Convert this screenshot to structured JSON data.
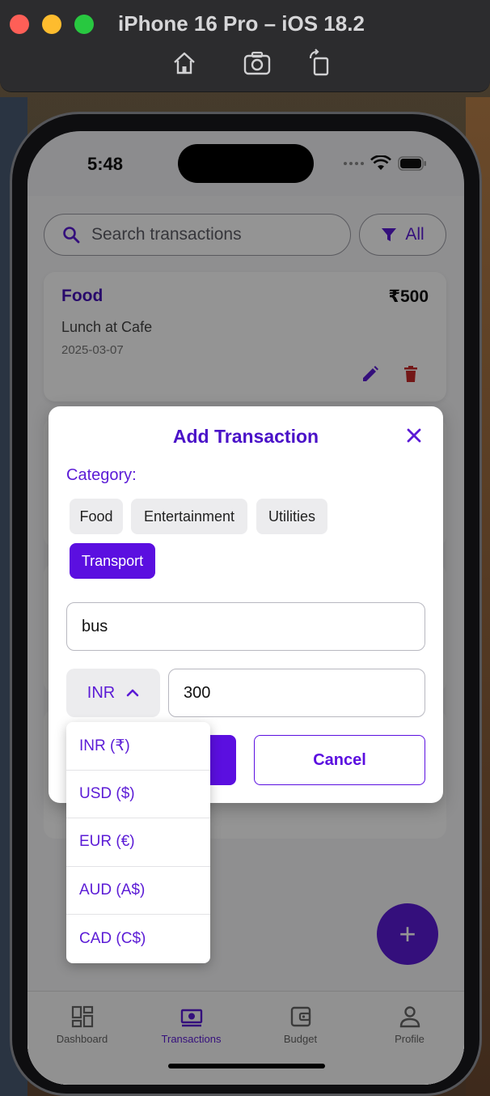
{
  "simulator": {
    "title": "iPhone 16 Pro – iOS 18.2",
    "tools": [
      "home-icon",
      "screenshot-icon",
      "rotate-icon"
    ]
  },
  "status_bar": {
    "time": "5:48"
  },
  "search": {
    "placeholder": "Search transactions"
  },
  "filter": {
    "label": "All"
  },
  "transaction": {
    "category": "Food",
    "amount": "₹500",
    "description": "Lunch at Cafe",
    "date": "2025-03-07"
  },
  "modal": {
    "title": "Add Transaction",
    "category_label": "Category:",
    "categories": [
      "Food",
      "Entertainment",
      "Utilities",
      "Transport"
    ],
    "selected_category": "Transport",
    "description_value": "bus",
    "currency_value": "INR",
    "amount_value": "300",
    "cancel_label": "Cancel"
  },
  "currency_options": [
    "INR (₹)",
    "USD ($)",
    "EUR (€)",
    "AUD (A$)",
    "CAD (C$)"
  ],
  "tabs": [
    {
      "label": "Dashboard",
      "icon": "dashboard-icon"
    },
    {
      "label": "Transactions",
      "icon": "wallet-cash-icon"
    },
    {
      "label": "Budget",
      "icon": "wallet-icon"
    },
    {
      "label": "Profile",
      "icon": "person-icon"
    }
  ],
  "active_tab": "Transactions",
  "colors": {
    "accent": "#5B1BD6",
    "accent_dark": "#4A12C8",
    "delete": "#C62828"
  }
}
